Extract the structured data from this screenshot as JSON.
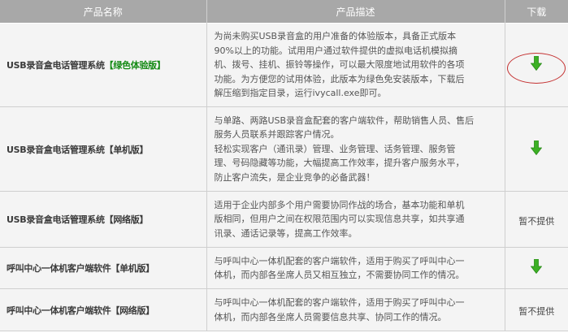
{
  "header": {
    "col_name": "产品名称",
    "col_desc": "产品描述",
    "col_download": "下载"
  },
  "rows": [
    {
      "name": "USB录音盒电话管理系统",
      "edition": "【绿色体验版】",
      "edition_color": "#148a14",
      "desc_lines": [
        "为尚未购买USB录音盒的用户准备的体验版本，具备正式版本",
        "90%以上的功能。试用用户通过软件提供的虚拟电话机模拟摘",
        "机、拨号、挂机、振铃等操作，可以最大限度地试用软件的各项",
        "功能。为方便您的试用体验，此版本为绿色免安装版本，下载后",
        "解压缩到指定目录，运行ivycall.exe即可。"
      ],
      "download": {
        "available": true,
        "icon": "green-down-arrow-icon",
        "highlighted": true
      }
    },
    {
      "name": "USB录音盒电话管理系统",
      "edition": "【单机版】",
      "edition_color": "",
      "desc_lines": [
        "与单路、两路USB录音盒配套的客户端软件，帮助销售人员、售后",
        "服务人员联系并跟踪客户情况。",
        "轻松实现客户（通讯录）管理、业务管理、话务管理、服务管",
        "理、号码隐藏等功能，大幅提高工作效率，提升客户服务水平，",
        "防止客户流失，是企业竞争的必备武器！"
      ],
      "download": {
        "available": true,
        "icon": "green-down-arrow-icon"
      }
    },
    {
      "name": "USB录音盒电话管理系统",
      "edition": "【网络版】",
      "edition_color": "",
      "desc_lines": [
        "适用于企业内部多个用户需要协同作战的场合，基本功能和单机",
        "版相同，但用户之间在权限范围内可以实现信息共享，如共享通",
        "讯录、通话记录等，提高工作效率。"
      ],
      "download": {
        "available": false,
        "text": "暂不提供"
      }
    },
    {
      "name": "呼叫中心一体机客户端软件",
      "edition": "【单机版】",
      "edition_color": "",
      "desc_lines": [
        "与呼叫中心一体机配套的客户端软件，适用于购买了呼叫中心一",
        "体机，而内部各坐席人员又相互独立，不需要协同工作的情况。"
      ],
      "download": {
        "available": true,
        "icon": "green-down-arrow-icon"
      }
    },
    {
      "name": "呼叫中心一体机客户端软件",
      "edition": "【网络版】",
      "edition_color": "",
      "desc_lines": [
        "与呼叫中心一体机配套的客户端软件，适用于购买了呼叫中心一",
        "体机，而内部各坐席人员需要信息共享、协同工作的情况。"
      ],
      "download": {
        "available": false,
        "text": "暂不提供"
      }
    }
  ]
}
